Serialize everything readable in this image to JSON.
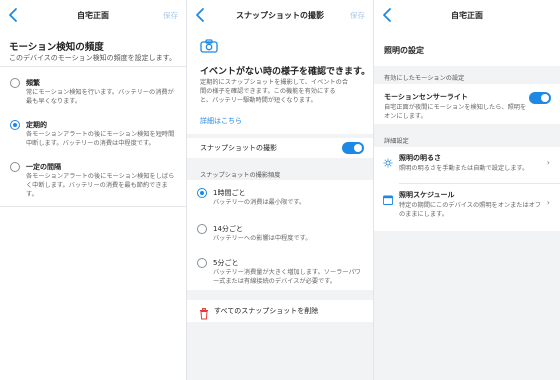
{
  "screen1": {
    "title": "自宅正面",
    "save": "保存",
    "heading": "モーション検知の頻度",
    "description": "このデバイスのモーション検知の頻度を設定します。",
    "options": [
      {
        "title": "頻繁",
        "line1": "常にモーション検知を行います。バッテリーの消費が",
        "line2": "最も早くなります。",
        "selected": false
      },
      {
        "title": "定期的",
        "line1": "各モーションアラートの後にモーション検知を短時間",
        "line2": "中断します。バッテリーの消費は中程度です。",
        "selected": true
      },
      {
        "title": "一定の間隔",
        "line1": "各モーションアラートの後にモーション検知をしばら",
        "line2": "く中断します。バッテリーの消費を最も節約できま",
        "line3": "す。",
        "selected": false
      }
    ]
  },
  "screen2": {
    "title": "スナップショットの撮影",
    "save": "保存",
    "hero_title": "イベントがない時の様子を確認できます。",
    "hero_line1": "定期的にスナップショットを撮影して、イベントの合",
    "hero_line2": "間の様子を確認できます。この機能を有効にする",
    "hero_line3": "と、バッテリー駆動時間が短くなります。",
    "details_link": "詳細はこちら",
    "toggle_label": "スナップショットの撮影",
    "toggle_on": true,
    "frequency_label": "スナップショットの撮影頻度",
    "options": [
      {
        "title": "1時間ごと",
        "line1": "バッテリーの消費は最小限です。",
        "selected": true
      },
      {
        "title": "14分ごと",
        "line1": "バッテリーへの影響は中程度です。",
        "selected": false
      },
      {
        "title": "5分ごと",
        "line1": "バッテリー消費量が大きく増加します。ソーラーパワ",
        "line2": "ー式または有線接続のデバイスが必要です。",
        "selected": false
      }
    ],
    "delete_label": "すべてのスナップショットを削除"
  },
  "screen3": {
    "title": "自宅正面",
    "heading": "照明の設定",
    "section1": "有効にしたモーションの設定",
    "motion_light_title": "モーションセンサーライト",
    "motion_light_line1": "自宅正面が夜間にモーションを検知したら、照明を",
    "motion_light_line2": "オンにします。",
    "motion_light_on": true,
    "section2": "詳細設定",
    "brightness_title": "照明の明るさ",
    "brightness_desc": "照明の明るさを手動または自動で設定します。",
    "schedule_title": "照明スケジュール",
    "schedule_line1": "特定の期間にこのデバイスの照明をオンまたはオフ",
    "schedule_line2": "のままにします。"
  },
  "colors": {
    "accent": "#1e88e5",
    "save_disabled": "#a9c8e6",
    "delete_icon": "#e53935"
  },
  "icons": [
    "back-chevron-icon",
    "camera-icon",
    "trash-icon",
    "sun-icon",
    "calendar-icon",
    "chevron-right-icon"
  ]
}
